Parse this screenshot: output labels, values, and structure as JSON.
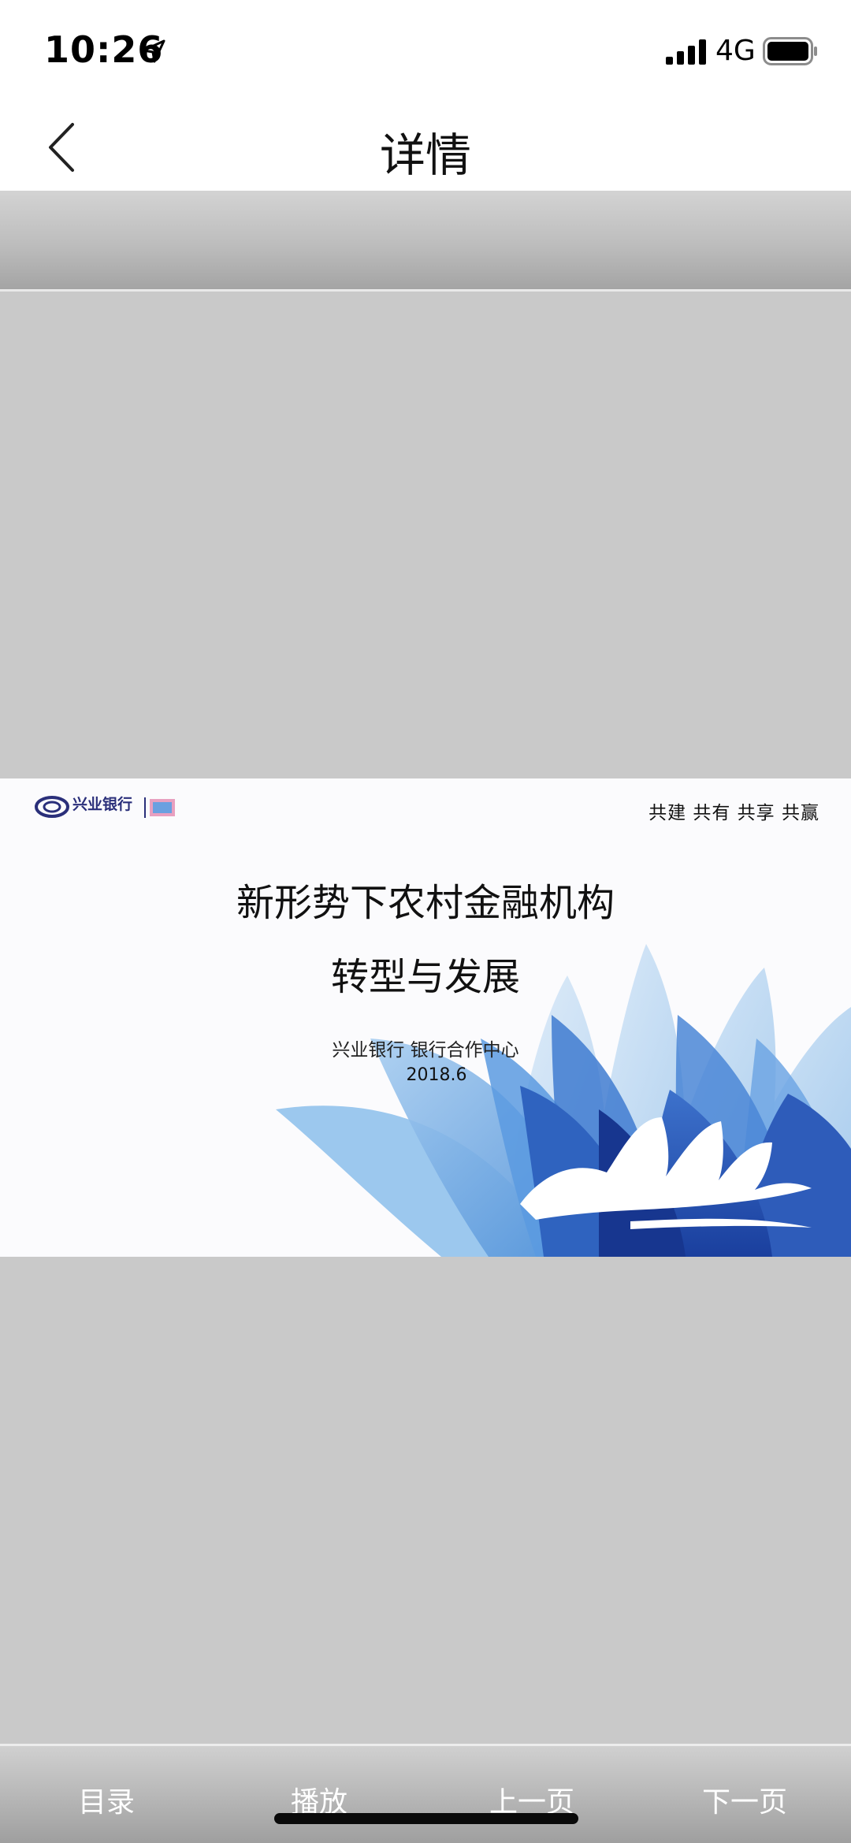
{
  "status_bar": {
    "time": "10:26",
    "network": "4G",
    "icons": [
      "location-arrow-icon",
      "signal-bars-icon",
      "battery-icon"
    ]
  },
  "nav": {
    "title": "详情",
    "back_icon": "chevron-left-icon"
  },
  "slide": {
    "logo_text": "兴业银行",
    "tagline": "共建 共有 共享 共赢",
    "title_line1": "新形势下农村金融机构",
    "title_line2": "转型与发展",
    "organization": "兴业银行 银行合作中心",
    "date": "2018.6",
    "colors": {
      "lotus_light": "#a9d0f0",
      "lotus_mid": "#4a8fd6",
      "lotus_dark": "#1f4eb0",
      "logo_navy": "#2a2f7a"
    }
  },
  "bottom_bar": {
    "buttons": [
      "目录",
      "播放",
      "上一页",
      "下一页"
    ]
  },
  "colors": {
    "viewer_bg": "#c9c9c9",
    "toolbar_gradient_end": "#a4a4a4",
    "bottom_text": "#ffffff"
  }
}
